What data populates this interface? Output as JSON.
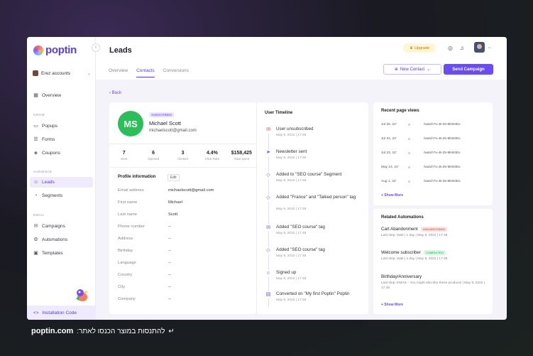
{
  "app": {
    "brand": "poptin"
  },
  "account": {
    "name": "Erez accounts"
  },
  "sidebar": {
    "overview": "Overview",
    "sections": {
      "grow": "GROW",
      "audience": "AUDIENCE",
      "email": "EMAIL"
    },
    "grow_items": [
      {
        "label": "Popups",
        "icon": "popup-icon"
      },
      {
        "label": "Forms",
        "icon": "forms-icon"
      },
      {
        "label": "Coupons",
        "icon": "coupon-icon"
      }
    ],
    "audience_items": [
      {
        "label": "Leads",
        "icon": "leads-icon"
      },
      {
        "label": "Segments",
        "icon": "segments-icon"
      }
    ],
    "email_items": [
      {
        "label": "Campaigns",
        "icon": "mail-icon"
      },
      {
        "label": "Automations",
        "icon": "automation-icon"
      },
      {
        "label": "Templates",
        "icon": "templates-icon"
      }
    ],
    "install": "Installation Code"
  },
  "header": {
    "title": "Leads",
    "upgrade": "Upgrade"
  },
  "tabs": [
    "Overview",
    "Contacts",
    "Conversions"
  ],
  "actions": {
    "new_contact": "New Contact",
    "send_campaign": "Send Campaign"
  },
  "back": "Back",
  "profile": {
    "initials": "MS",
    "badge": "SUBSCRIBED",
    "name": "Michael Scott",
    "email": "michaelscott@gmail.com",
    "stats": [
      {
        "value": "7",
        "label": "Sent"
      },
      {
        "value": "6",
        "label": "Opened"
      },
      {
        "value": "3",
        "label": "Clicked"
      },
      {
        "value": "4.4%",
        "label": "Click Rate"
      },
      {
        "value": "$158,425",
        "label": "Total spent"
      }
    ],
    "info_title": "Profile information",
    "edit": "Edit",
    "fields": [
      {
        "label": "Email address",
        "value": "michaelscott@gmail.com"
      },
      {
        "label": "First name",
        "value": "Michael"
      },
      {
        "label": "Last name",
        "value": "Scott"
      },
      {
        "label": "Phone number",
        "value": "--"
      },
      {
        "label": "Address",
        "value": "--"
      },
      {
        "label": "Birthday",
        "value": "--"
      },
      {
        "label": "Language",
        "value": "--"
      },
      {
        "label": "Country",
        "value": "--"
      },
      {
        "label": "City",
        "value": "--"
      },
      {
        "label": "Company",
        "value": "--"
      }
    ]
  },
  "timeline": {
    "title": "User Timeline",
    "events": [
      {
        "text": "User unsubscribed",
        "date": "May 9, 2022 | 17:48",
        "icon": "mail-icon"
      },
      {
        "text": "Newsletter sent",
        "date": "May 9, 2022 | 17:48",
        "icon": "send-icon"
      },
      {
        "text": "Added to \"SEO course\" Segment",
        "date": "May 9, 2022 | 17:48",
        "icon": "tag-icon"
      },
      {
        "text": "Added \"France\" and \"Talked person\" tag",
        "date": "May 9, 2022 | 17:48",
        "icon": "tag-icon"
      },
      {
        "text": "Added \"SEO course\" tag",
        "date": "May 9, 2022 | 17:48",
        "icon": "mail-icon"
      },
      {
        "text": "Added \"SEO course\" tag",
        "date": "May 9, 2022 | 17:48",
        "icon": "tag-icon"
      },
      {
        "text": "Signed up",
        "date": "May 9, 2022 | 17:48",
        "icon": "user-icon"
      },
      {
        "text": "Converted on \"My first Poptin\" Poptin",
        "date": "May 9, 2022 | 17:48",
        "icon": "form-icon"
      }
    ]
  },
  "recent": {
    "title": "Recent page views",
    "rows": [
      {
        "date": "Jul 25, 22'",
        "url": "/watch?v=B-25-9kW3Eo"
      },
      {
        "date": "Jul 24, 22'",
        "url": "/watch?v=B-25-9kW3Eo"
      },
      {
        "date": "Jul 23, 22'",
        "url": "/watch?v=B-25-9kW3Eo"
      },
      {
        "date": "May 24, 22'",
        "url": "/watch?v=B-25-9kW3Eo"
      },
      {
        "date": "Aug 1, 22'",
        "url": "/watch?v=B-25-9kW3Eo"
      }
    ],
    "more": "+ Show More"
  },
  "automations": {
    "title": "Related Automations",
    "items": [
      {
        "name": "Cart Abandonment",
        "pill": "UNSUBSCRIBED",
        "pill_color": "red",
        "sub": "Last step: Wait | 1 day | May 9, 2022 | 17:48"
      },
      {
        "name": "Welcome subscriber",
        "pill": "COMPLETED",
        "pill_color": "green",
        "sub": "Last step: Wait | 1 day | May 9, 2022 | 17:48"
      },
      {
        "name": "Birthday/Anniversary",
        "pill": "",
        "pill_color": "",
        "sub": "Last step: EMAIL - You might also like these products | May 9, 2022 | 17:48"
      }
    ],
    "more": "+ Show More"
  },
  "footer": {
    "site": "poptin.com",
    "cta": "להתנסות במוצר הכנסו לאתר:"
  }
}
